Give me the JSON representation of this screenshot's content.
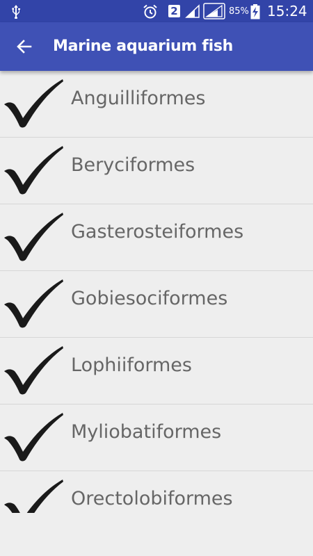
{
  "status_bar": {
    "sim_slot": "2",
    "battery_percent": "85%",
    "time": "15:24",
    "icons": [
      "usb-icon",
      "alarm-icon",
      "signal-icon",
      "battery-charging-icon"
    ]
  },
  "app_bar": {
    "title": "Marine aquarium fish",
    "back_icon": "arrow-back-icon"
  },
  "list": {
    "items": [
      {
        "label": "Anguilliformes",
        "checked": true
      },
      {
        "label": "Beryciformes",
        "checked": true
      },
      {
        "label": "Gasterosteiformes",
        "checked": true
      },
      {
        "label": "Gobiesociformes",
        "checked": true
      },
      {
        "label": "Lophiiformes",
        "checked": true
      },
      {
        "label": "Myliobatiformes",
        "checked": true
      },
      {
        "label": "Orectolobiformes",
        "checked": true
      }
    ]
  },
  "colors": {
    "status_bar": "#3244a8",
    "app_bar": "#3f51b5",
    "background": "#eeeeee",
    "label_text": "#666666",
    "checkmark": "#1a1a1a"
  }
}
